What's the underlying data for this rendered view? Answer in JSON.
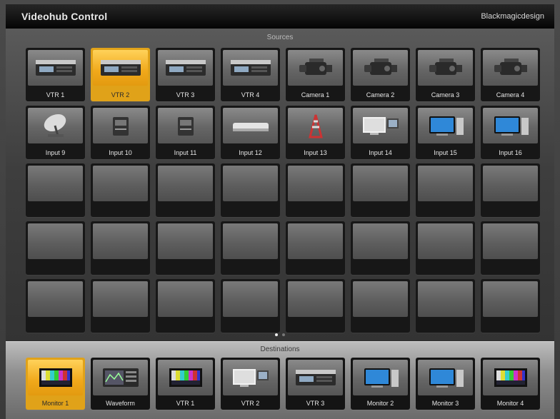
{
  "window": {
    "title": "Videohub Control",
    "brand": "Blackmagicdesign"
  },
  "sources": {
    "title": "Sources",
    "selected": "VTR 2",
    "items": [
      {
        "label": "VTR 1",
        "icon": "vtr-deck-icon"
      },
      {
        "label": "VTR 2",
        "icon": "vtr-deck-icon"
      },
      {
        "label": "VTR 3",
        "icon": "vtr-deck-icon"
      },
      {
        "label": "VTR 4",
        "icon": "vtr-deck-icon"
      },
      {
        "label": "Camera 1",
        "icon": "camera-icon"
      },
      {
        "label": "Camera 2",
        "icon": "camera-icon"
      },
      {
        "label": "Camera 3",
        "icon": "camera-icon"
      },
      {
        "label": "Camera 4",
        "icon": "camera-icon"
      },
      {
        "label": "Input 9",
        "icon": "satellite-dish-icon"
      },
      {
        "label": "Input 10",
        "icon": "converter-box-icon"
      },
      {
        "label": "Input 11",
        "icon": "converter-box-icon"
      },
      {
        "label": "Input 12",
        "icon": "rack-unit-icon"
      },
      {
        "label": "Input 13",
        "icon": "antenna-tower-icon"
      },
      {
        "label": "Input 14",
        "icon": "workstation-icon"
      },
      {
        "label": "Input 15",
        "icon": "computer-icon"
      },
      {
        "label": "Input 16",
        "icon": "computer-icon"
      }
    ],
    "empty_slots": 24
  },
  "pager": {
    "pages": 2,
    "current": 1
  },
  "destinations": {
    "title": "Destinations",
    "selected": "Monitor 1",
    "items": [
      {
        "label": "Monitor 1",
        "icon": "color-bars-monitor-icon"
      },
      {
        "label": "Waveform",
        "icon": "waveform-monitor-icon"
      },
      {
        "label": "VTR 1",
        "icon": "color-bars-monitor-icon"
      },
      {
        "label": "VTR 2",
        "icon": "workstation-icon"
      },
      {
        "label": "VTR 3",
        "icon": "vtr-deck-icon"
      },
      {
        "label": "Monitor 2",
        "icon": "computer-icon"
      },
      {
        "label": "Monitor 3",
        "icon": "computer-icon"
      },
      {
        "label": "Monitor 4",
        "icon": "color-bars-monitor-icon"
      }
    ]
  },
  "colors": {
    "active": "#f0a81a",
    "tile": "#6a6a6a",
    "titlebar": "#111111"
  }
}
